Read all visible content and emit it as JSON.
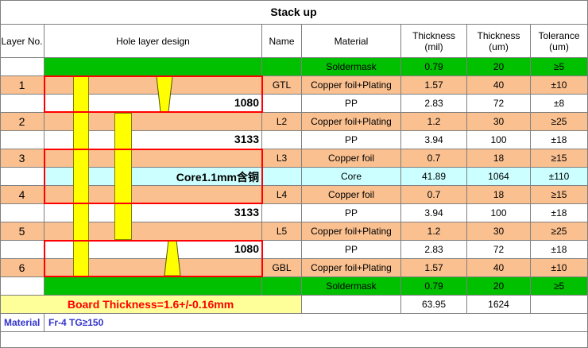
{
  "title": "Stack up",
  "headers": {
    "layer_no": "Layer No.",
    "hole_layer_design": "Hole layer design",
    "name": "Name",
    "material": "Material",
    "thickness_mil": "Thickness\n(mil)",
    "thickness_um": "Thickness\n(um)",
    "tolerance_um": "Tolerance\n(um)"
  },
  "rows": [
    {
      "layer": "",
      "name": "",
      "material": "Soldermask",
      "mil": "0.79",
      "um": "20",
      "tol": "≥5",
      "style": "green"
    },
    {
      "layer": "1",
      "name": "GTL",
      "material": "Copper foil+Plating",
      "mil": "1.57",
      "um": "40",
      "tol": "±10",
      "style": "peach"
    },
    {
      "layer": "",
      "name": "",
      "material": "PP",
      "mil": "2.83",
      "um": "72",
      "tol": "±8",
      "style": "white"
    },
    {
      "layer": "2",
      "name": "L2",
      "material": "Copper foil+Plating",
      "mil": "1.2",
      "um": "30",
      "tol": "≥25",
      "style": "peach"
    },
    {
      "layer": "",
      "name": "",
      "material": "PP",
      "mil": "3.94",
      "um": "100",
      "tol": "±18",
      "style": "white"
    },
    {
      "layer": "3",
      "name": "L3",
      "material": "Copper foil",
      "mil": "0.7",
      "um": "18",
      "tol": "≥15",
      "style": "peach"
    },
    {
      "layer": "",
      "name": "",
      "material": "Core",
      "mil": "41.89",
      "um": "1064",
      "tol": "±110",
      "style": "cyan"
    },
    {
      "layer": "4",
      "name": "L4",
      "material": "Copper foil",
      "mil": "0.7",
      "um": "18",
      "tol": "≥15",
      "style": "peach"
    },
    {
      "layer": "",
      "name": "",
      "material": "PP",
      "mil": "3.94",
      "um": "100",
      "tol": "±18",
      "style": "white"
    },
    {
      "layer": "5",
      "name": "L5",
      "material": "Copper foil+Plating",
      "mil": "1.2",
      "um": "30",
      "tol": "≥25",
      "style": "peach"
    },
    {
      "layer": "",
      "name": "",
      "material": "PP",
      "mil": "2.83",
      "um": "72",
      "tol": "±18",
      "style": "white"
    },
    {
      "layer": "6",
      "name": "GBL",
      "material": "Copper foil+Plating",
      "mil": "1.57",
      "um": "40",
      "tol": "±10",
      "style": "peach"
    },
    {
      "layer": "",
      "name": "",
      "material": "Soldermask",
      "mil": "0.79",
      "um": "20",
      "tol": "≥5",
      "style": "green"
    }
  ],
  "hole_labels": {
    "pp_top": "1080",
    "pp_upper": "3133",
    "core": "Core1.1mm含铜",
    "pp_lower": "3133",
    "pp_bottom": "1080"
  },
  "totals": {
    "board_thickness": "Board Thickness=1.6+/-0.16mm",
    "mil": "63.95",
    "um": "1624"
  },
  "footer": {
    "material_label": "Material",
    "material_value": "Fr-4  TG≥150"
  },
  "colors": {
    "soldermask": "#00c000",
    "copper": "#fac090",
    "core": "#ccffff",
    "board_row": "#ffff99",
    "hole_fill": "#ffff00",
    "highlight": "#ff0000"
  }
}
